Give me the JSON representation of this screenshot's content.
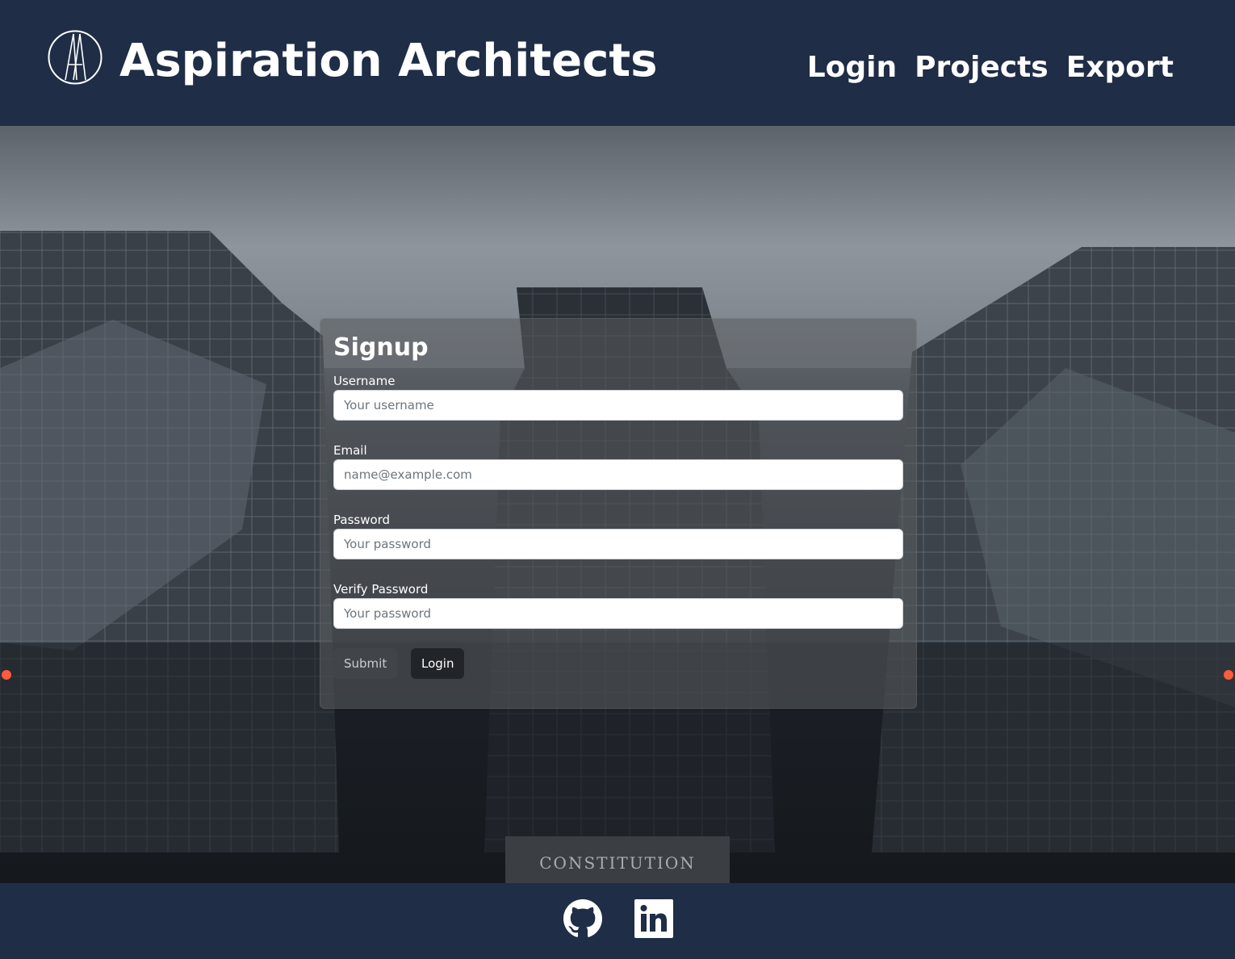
{
  "header": {
    "brand": "Aspiration Architects",
    "logo_icon": "aa-monogram-logo",
    "nav": [
      {
        "label": "Login"
      },
      {
        "label": "Projects"
      },
      {
        "label": "Export"
      }
    ]
  },
  "form": {
    "title": "Signup",
    "fields": [
      {
        "label": "Username",
        "placeholder": "Your username"
      },
      {
        "label": "Email",
        "placeholder": "name@example.com"
      },
      {
        "label": "Password",
        "placeholder": "Your password"
      },
      {
        "label": "Verify Password",
        "placeholder": "Your password"
      }
    ],
    "submit_label": "Submit",
    "login_label": "Login"
  },
  "footer": {
    "icons": [
      "github-icon",
      "linkedin-icon"
    ]
  },
  "colors": {
    "header_bg": "#1f2d46",
    "card_bg": "rgba(90,92,96,0.55)",
    "login_button_bg": "#212529"
  }
}
